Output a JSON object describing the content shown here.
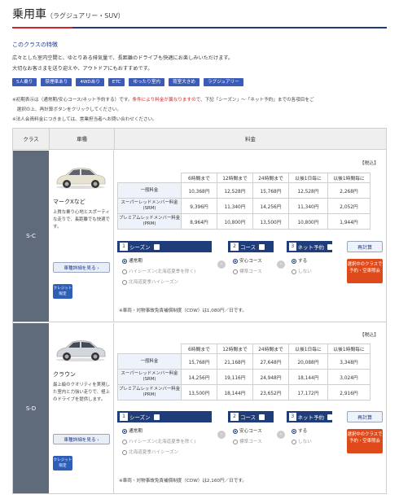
{
  "header": {
    "title": "乗用車",
    "subtitle": "（ラグジュアリー・SUV）"
  },
  "features": {
    "heading": "このクラスの特徴",
    "lines": [
      "広々とした室内空間と、ゆとりある排気量で、長距離のドライブも快適にお楽しみいただけます。",
      "大切なお客さまを送り迎えや、アウトドアにもおすすめです。"
    ],
    "tags": [
      "5人乗り",
      "禁煙車あり",
      "4WDあり",
      "ETC",
      "ゆったり室内",
      "荷室大きめ",
      "ラグジュアリー"
    ]
  },
  "notes": {
    "line1_pre": "※初期表示は（通常期/安心コース/ネット予約する）です。",
    "line1_red": "条件により料金が異なりますので",
    "line1_post": "、下記「シーズン」～「ネット予約」までの各項目をご",
    "line2": "　選択の上、再計算ボタンをクリックしてください。",
    "line3": "※法人会員料金につきましては、営業担当者へお問い合わせください。"
  },
  "table": {
    "headers": {
      "class": "クラス",
      "model": "車種",
      "price": "料金"
    },
    "tax_label": "【税込】",
    "price_cols": [
      "6時間まで",
      "12時間まで",
      "24時間まで",
      "以後1日毎に",
      "以後1時間毎に"
    ],
    "rows": [
      {
        "class": "S-C",
        "car_name": "マークXなど",
        "car_desc": "上質な乗り心地とスポーティな走りで、長距離でも快適です。",
        "detail_button": "車種詳細を見る ›",
        "credit_badge": "クレジット限定",
        "prices": [
          {
            "label": "一般料金",
            "values": [
              "10,368円",
              "12,528円",
              "15,768円",
              "12,528円",
              "2,268円"
            ]
          },
          {
            "label": "スーパーレッドメンバー料金(SRM)",
            "values": [
              "9,396円",
              "11,340円",
              "14,256円",
              "11,340円",
              "2,052円"
            ]
          },
          {
            "label": "プレミアムレッドメンバー料金(PRM)",
            "values": [
              "8,964円",
              "10,800円",
              "13,500円",
              "10,800円",
              "1,944円"
            ]
          }
        ],
        "cdw": "※車両・対物事故免責補償制度（CDW）は1,080円／日です。"
      },
      {
        "class": "S-D",
        "car_name": "クラウン",
        "car_desc": "最上級のクオリティを実現した室内と力強い走りで、極上のドライブを提供します。",
        "detail_button": "車種詳細を見る ›",
        "credit_badge": "クレジット限定",
        "prices": [
          {
            "label": "一般料金",
            "values": [
              "15,768円",
              "21,168円",
              "27,648円",
              "20,088円",
              "3,348円"
            ]
          },
          {
            "label": "スーパーレッドメンバー料金(SRM)",
            "values": [
              "14,256円",
              "19,116円",
              "24,948円",
              "18,144円",
              "3,024円"
            ]
          },
          {
            "label": "プレミアムレッドメンバー料金(PRM)",
            "values": [
              "13,500円",
              "18,144円",
              "23,652円",
              "17,172円",
              "2,916円"
            ]
          }
        ],
        "cdw": "※車両・対物事故免責補償制度（CDW）は2,160円／日です。"
      }
    ],
    "options": {
      "season": {
        "num": "1",
        "title": "シーズン",
        "items": [
          "通常期",
          "ハイシーズン(北海道夏季を除く)",
          "北海道夏季ハイシーズン"
        ]
      },
      "course": {
        "num": "2",
        "title": "コース",
        "items": [
          "安心コース",
          "標準コース"
        ]
      },
      "net": {
        "num": "3",
        "title": "ネット予約",
        "items": [
          "する",
          "しない"
        ]
      },
      "recalc": "再計算",
      "reserve": "選択中のクラスで予約・空車照会"
    }
  },
  "colors": {
    "navy": "#1f3d7a",
    "accent_red": "#d2232a",
    "tag_blue": "#3b5bb6",
    "reserve_orange": "#e04a1a"
  }
}
